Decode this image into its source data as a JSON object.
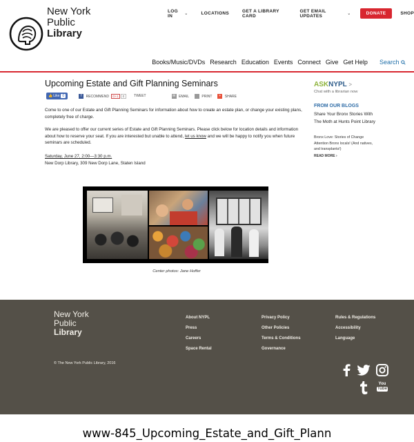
{
  "header": {
    "brand": [
      "New York",
      "Public",
      "Library"
    ],
    "util_nav": [
      {
        "label": "LOG IN",
        "chevron": true
      },
      {
        "label": "LOCATIONS",
        "chevron": false
      },
      {
        "label": "GET A LIBRARY CARD",
        "chevron": false
      },
      {
        "label": "GET EMAIL UPDATES",
        "chevron": true
      }
    ],
    "donate": "DONATE",
    "shop": "SHOP",
    "main_nav": [
      "Books/Music/DVDs",
      "Research",
      "Education",
      "Events",
      "Connect",
      "Give",
      "Get Help"
    ],
    "search": "Search",
    "accent": "#d8262f"
  },
  "article": {
    "title": "Upcoming Estate and Gift Planning Seminars",
    "share": {
      "like": "Like",
      "like_count": "0",
      "recommend": "RECOMMEND",
      "gplus": "G+1",
      "gplus_count": "0",
      "tweet": "TWEET",
      "email": "EMAIL",
      "print": "PRINT",
      "share": "SHARE"
    },
    "p1": "Come to one of our Estate and Gift Planning Seminars for information about how to create an estate plan, or change your existing plans, completely free of charge.",
    "p2_a": "We are pleased to offer our current series of Estate and Gift Planning Seminars.  Please click below for location details and information about how to reserve your seat. If you are interested but unable to attend, ",
    "p2_link": "let us know",
    "p2_b": " and we will be happy to notify you when future seminars are scheduled.",
    "event_date": "Saturday, June 27, 2:00—3:30 p.m.",
    "event_place": "New Dorp Library, 309 New Dorp Lane, Staten Island",
    "caption": "Center photos: Jane Hoffer"
  },
  "sidebar": {
    "ask_1": "ASK",
    "ask_2": "NYPL",
    "ask_arrow": ">",
    "chat": "Chat with a librarian now",
    "blogs_heading": "FROM OUR BLOGS",
    "blog_title": "Share Your Bronx Stories With The Moth at Hunts Point Library",
    "blog_desc": "Bronx Love: Stories of Change Attention Bronx locals! (And natives, and transplants!)",
    "read_more": "READ MORE ›"
  },
  "footer": {
    "brand": [
      "New York",
      "Public",
      "Library"
    ],
    "col1": [
      "About NYPL",
      "Press",
      "Careers",
      "Space Rental"
    ],
    "col2": [
      "Privacy Policy",
      "Other Policies",
      "Terms & Conditions",
      "Governance"
    ],
    "col3": [
      "Rules & Regulations",
      "Accessibility",
      "Language"
    ],
    "copyright": "© The New York Public Library, 2016",
    "youtube": [
      "You",
      "Tube"
    ],
    "social_icons": [
      "facebook-icon",
      "twitter-icon",
      "instagram-icon",
      "tumblr-icon",
      "youtube-icon"
    ]
  },
  "bottom_label": "www-845_Upcoming_Estate_and_Gift_Plann"
}
